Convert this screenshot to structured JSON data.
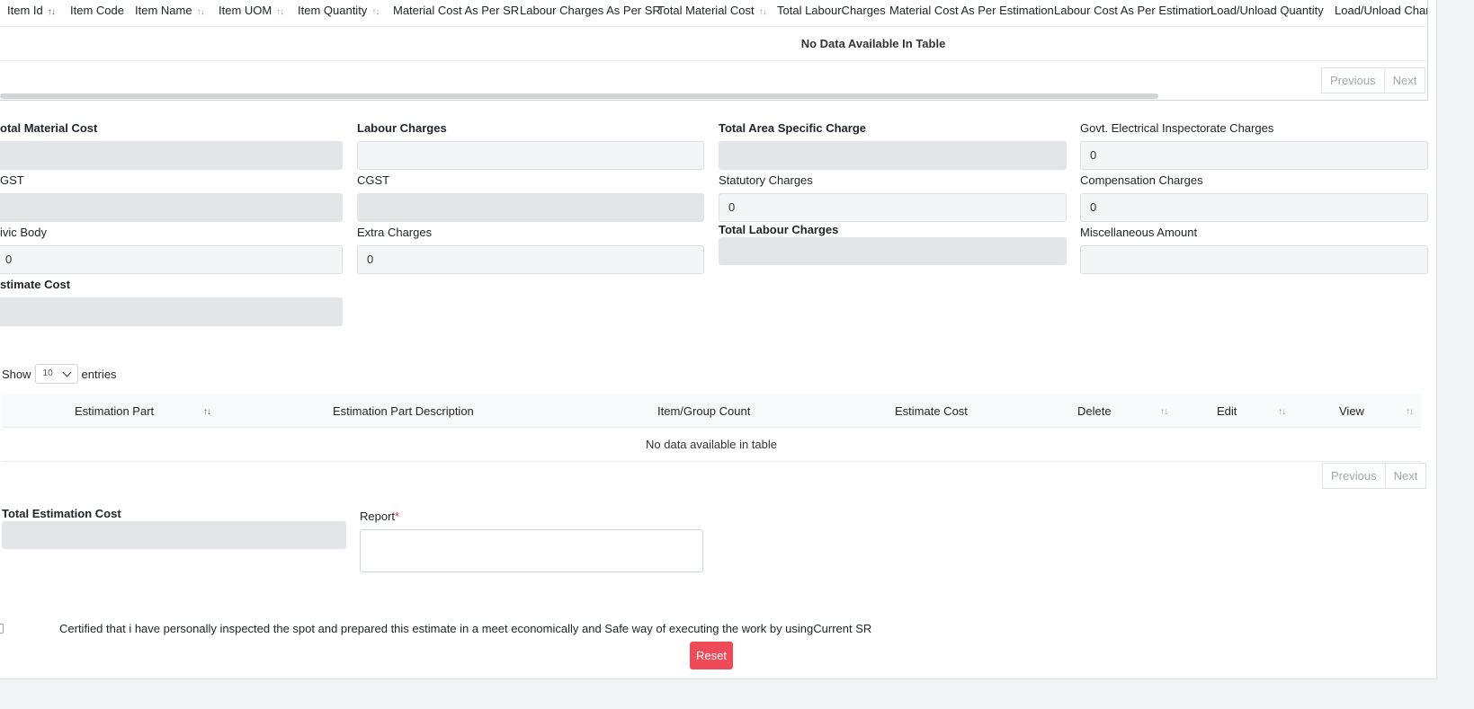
{
  "item_table": {
    "columns": [
      {
        "label": "Item Id",
        "sort": "asc"
      },
      {
        "label": "Item Code",
        "sort": ""
      },
      {
        "label": "Item Name",
        "sort": "both"
      },
      {
        "label": "Item UOM",
        "sort": "both"
      },
      {
        "label": "Item Quantity",
        "sort": "both"
      },
      {
        "label": "Material Cost As Per SR",
        "sort": ""
      },
      {
        "label": "Labour Charges As Per SR",
        "sort": ""
      },
      {
        "label": "Total Material Cost",
        "sort": "both"
      },
      {
        "label": "Total LabourCharges",
        "sort": ""
      },
      {
        "label": "Material Cost As Per Estimation",
        "sort": ""
      },
      {
        "label": "Labour Cost As Per Estimation",
        "sort": ""
      },
      {
        "label": "Load/Unload Quantity",
        "sort": ""
      },
      {
        "label": "Load/Unload Charg",
        "sort": ""
      }
    ],
    "empty_message": "No Data Available In Table",
    "previous_label": "Previous",
    "next_label": "Next"
  },
  "cost_fields": {
    "total_material_cost": {
      "label": "otal Material Cost",
      "value": ""
    },
    "labour_charges": {
      "label": "Labour Charges",
      "value": ""
    },
    "total_area_specific_charge": {
      "label": "Total Area Specific Charge",
      "value": ""
    },
    "govt_electrical_charges": {
      "label": "Govt. Electrical Inspectorate Charges",
      "value": "0"
    },
    "sgst": {
      "label": "GST",
      "value": ""
    },
    "cgst": {
      "label": "CGST",
      "value": ""
    },
    "statutory_charges": {
      "label": "Statutory Charges",
      "value": "0"
    },
    "compensation_charges": {
      "label": "Compensation Charges",
      "value": "0"
    },
    "civic_body": {
      "label": "ivic Body",
      "value": "0"
    },
    "extra_charges": {
      "label": "Extra Charges",
      "value": "0"
    },
    "total_labour_charges": {
      "label": "Total Labour Charges",
      "value": ""
    },
    "miscellaneous_amount": {
      "label": "Miscellaneous Amount",
      "value": ""
    },
    "estimate_cost": {
      "label": "stimate Cost",
      "value": ""
    }
  },
  "entries": {
    "show_label": "Show",
    "selected": "10",
    "entries_label": "entries"
  },
  "estimation_table": {
    "columns": [
      "Estimation Part",
      "Estimation Part Description",
      "Item/Group Count",
      "Estimate Cost",
      "Delete",
      "Edit",
      "View"
    ],
    "empty_message": "No data available in table",
    "previous_label": "Previous",
    "next_label": "Next"
  },
  "summary": {
    "total_estimation_cost_label": "Total Estimation Cost",
    "total_estimation_cost_value": "",
    "report_label": "Report",
    "report_required_mark": "*"
  },
  "certification_text": "Certified that i have personally inspected the spot and prepared this estimate in a meet economically and Safe way of executing the work by usingCurrent SR",
  "reset_label": "Reset",
  "colors": {
    "reset_button": "#ef4a57",
    "readonly_field": "#e3e5e8",
    "editable_field": "#f4f5f7",
    "required": "#dc3545"
  }
}
